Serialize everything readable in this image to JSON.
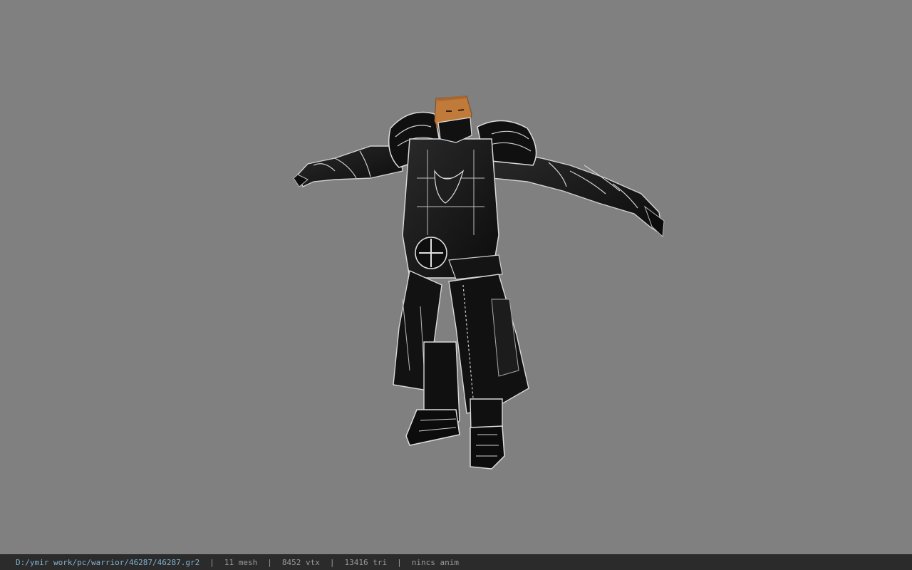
{
  "viewport": {
    "background_color": "#808080",
    "model_name": "warrior armor model",
    "model_colors": {
      "armor": "#141414",
      "trim": "#d8d8d8",
      "skin": "#c07a3a"
    }
  },
  "status_bar": {
    "file_path": "D:/ymir work/pc/warrior/46287/46287.gr2",
    "separator": "|",
    "mesh_count": "11 mesh",
    "vertex_count": "8452 vtx",
    "triangle_count": "13416 tri",
    "anim_status": "nincs anim",
    "path_color": "#7fb2cf",
    "text_color": "#9a9a9a",
    "background_color": "#2b2b2b"
  }
}
